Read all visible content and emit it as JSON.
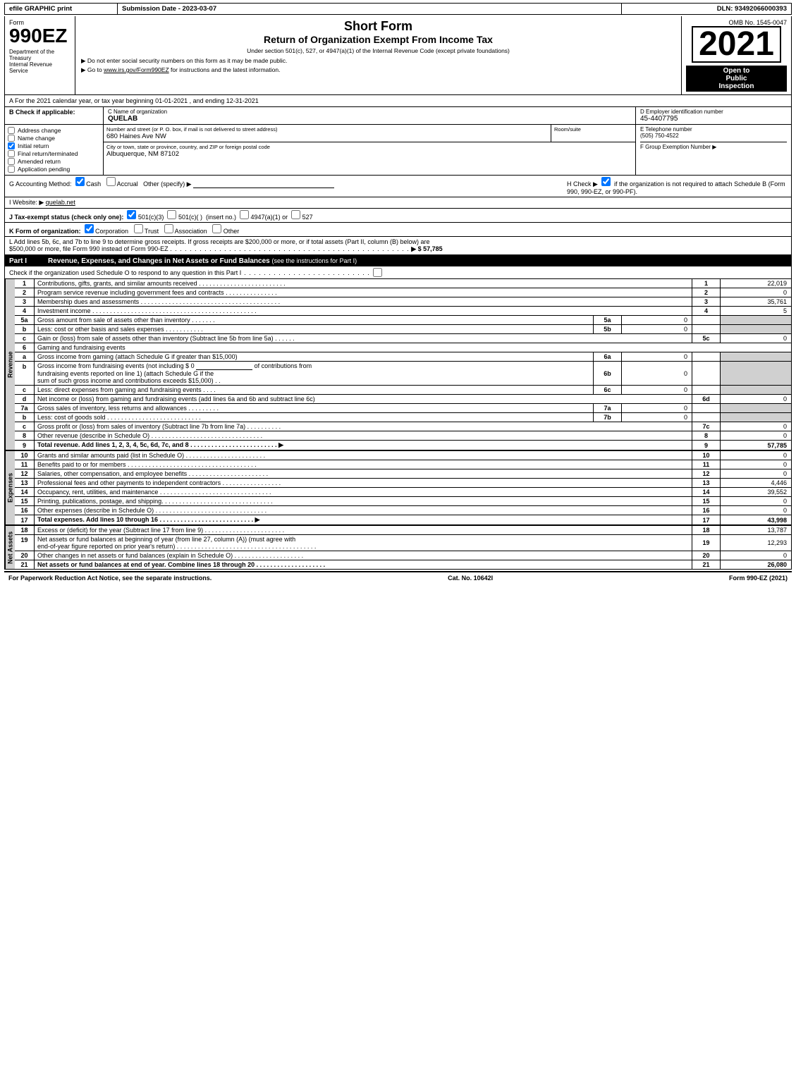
{
  "header": {
    "efile": "efile GRAPHIC print",
    "submission_label": "Submission Date - 2023-03-07",
    "dln": "DLN: 93492066000393"
  },
  "form_info": {
    "form_number": "990EZ",
    "dept_line1": "Department of the",
    "dept_line2": "Treasury",
    "dept_line3": "Internal Revenue",
    "dept_line4": "Service",
    "short_form": "Short Form",
    "title": "Return of Organization Exempt From Income Tax",
    "subtitle": "Under section 501(c), 527, or 4947(a)(1) of the Internal Revenue Code (except private foundations)",
    "instruction1": "▶ Do not enter social security numbers on this form as it may be made public.",
    "instruction2": "▶ Go to www.irs.gov/Form990EZ for instructions and the latest information.",
    "omb": "OMB No. 1545-0047",
    "year": "2021",
    "open_to_public": "Open to",
    "public": "Public",
    "inspection": "Inspection"
  },
  "section_a": {
    "text": "A For the 2021 calendar year, or tax year beginning 01-01-2021 , and ending 12-31-2021"
  },
  "section_b": {
    "label": "B Check if applicable:",
    "address_change": "Address change",
    "name_change": "Name change",
    "initial_return": "Initial return",
    "final_return": "Final return/terminated",
    "amended_return": "Amended return",
    "application_pending": "Application pending",
    "address_change_checked": false,
    "name_change_checked": false,
    "initial_return_checked": true,
    "final_return_checked": false,
    "amended_return_checked": false,
    "application_pending_checked": false
  },
  "section_c": {
    "label": "C Name of organization",
    "org_name": "QUELAB",
    "street_label": "Number and street (or P. O. box, if mail is not delivered to street address)",
    "street_value": "680 Haines Ave NW",
    "room_label": "Room/suite",
    "room_value": "",
    "city_label": "City or town, state or province, country, and ZIP or foreign postal code",
    "city_value": "Albuquerque, NM  87102"
  },
  "section_d": {
    "label": "D Employer identification number",
    "ein": "45-4407795"
  },
  "section_e": {
    "label": "E Telephone number",
    "phone": "(505) 750-4522"
  },
  "section_f": {
    "label": "F Group Exemption",
    "label2": "Number",
    "arrow": "▶"
  },
  "section_g": {
    "text": "G Accounting Method:",
    "cash_label": "Cash",
    "accrual_label": "Accrual",
    "other_label": "Other (specify) ▶",
    "cash_checked": true,
    "accrual_checked": false,
    "h_text": "H Check ▶",
    "h_checked": true,
    "h_detail": "if the organization is not required to attach Schedule B (Form 990, 990-EZ, or 990-PF)."
  },
  "section_i": {
    "label": "I Website: ▶",
    "website": "quelab.net"
  },
  "section_j": {
    "text": "J Tax-exempt status (check only one):",
    "opt1": "501(c)(3)",
    "opt2": "501(c)(  )",
    "opt3": "(insert no.)",
    "opt4": "4947(a)(1) or",
    "opt5": "527",
    "opt1_checked": true,
    "opt2_checked": false,
    "opt4_checked": false,
    "opt5_checked": false
  },
  "section_k": {
    "text": "K Form of organization:",
    "corp": "Corporation",
    "trust": "Trust",
    "assoc": "Association",
    "other": "Other",
    "corp_checked": true,
    "trust_checked": false,
    "assoc_checked": false
  },
  "section_l": {
    "line1": "L Add lines 5b, 6c, and 7b to line 9 to determine gross receipts. If gross receipts are $200,000 or more, or if total assets (Part II, column (B) below) are",
    "line2": "$500,000 or more, file Form 990 instead of Form 990-EZ",
    "dots": ". . . . . . . . . . . . . . . . . . . . . . . . . . . . . . . . . . . . . . . . . . . . . . . . .",
    "arrow": "▶ $",
    "value": "57,785"
  },
  "part1": {
    "label": "Part I",
    "title": "Revenue, Expenses, and Changes in Net Assets or Fund Balances",
    "see_instructions": "(see the instructions for Part I)",
    "check_text": "Check if the organization used Schedule O to respond to any question in this Part I",
    "dots": ". . . . . . . . . . . . . . . . . . . . . . . . . .",
    "checkbox": false,
    "rows": [
      {
        "num": "1",
        "label": "Contributions, gifts, grants, and similar amounts received",
        "dots": ". . . . . . . . . . . . . . . . . . . . . . . . .",
        "line": "1",
        "value": "22,019"
      },
      {
        "num": "2",
        "label": "Program service revenue including government fees and contracts",
        "dots": ". . . . . . . . . . . . . . .",
        "line": "2",
        "value": "0"
      },
      {
        "num": "3",
        "label": "Membership dues and assessments",
        "dots": ". . . . . . . . . . . . . . . . . . . . . . . . . . . . . . . . . . . . . . .",
        "line": "3",
        "value": "35,761"
      },
      {
        "num": "4",
        "label": "Investment income",
        "dots": ". . . . . . . . . . . . . . . . . . . . . . . . . . . . . . . . . . . . . . . . . . . . . . .",
        "line": "4",
        "value": "5"
      },
      {
        "num": "5a",
        "label": "Gross amount from sale of assets other than inventory",
        "dots": ". . . . . . .",
        "mid_label": "5a",
        "mid_value": "0",
        "line": "",
        "value": ""
      },
      {
        "num": "b",
        "label": "Less: cost or other basis and sales expenses",
        "dots": ". . . . . . . . . . .",
        "mid_label": "5b",
        "mid_value": "0",
        "line": "",
        "value": ""
      },
      {
        "num": "c",
        "label": "Gain or (loss) from sale of assets other than inventory (Subtract line 5b from line 5a)",
        "dots": ". . . . . .",
        "line": "5c",
        "value": "0"
      },
      {
        "num": "6",
        "label": "Gaming and fundraising events",
        "line": "",
        "value": ""
      },
      {
        "num": "a",
        "label": "Gross income from gaming (attach Schedule G if greater than $15,000)",
        "mid_label": "6a",
        "mid_value": "0",
        "line": "",
        "value": ""
      },
      {
        "num": "b",
        "label": "Gross income from fundraising events (not including $ 0 of contributions from fundraising events reported on line 1) (attach Schedule G if the sum of such gross income and contributions exceeds $15,000)",
        "mid_label": "6b",
        "mid_value": "0",
        "line": "",
        "value": "",
        "dots2": ". ."
      },
      {
        "num": "c",
        "label": "Less: direct expenses from gaming and fundraising events",
        "dots": ". . . .",
        "mid_label": "6c",
        "mid_value": "0",
        "line": "",
        "value": ""
      },
      {
        "num": "d",
        "label": "Net income or (loss) from gaming and fundraising events (add lines 6a and 6b and subtract line 6c)",
        "line": "6d",
        "value": "0"
      },
      {
        "num": "7a",
        "label": "Gross sales of inventory, less returns and allowances",
        "dots": ". . . . . . . . .",
        "mid_label": "7a",
        "mid_value": "0",
        "line": "",
        "value": ""
      },
      {
        "num": "b",
        "label": "Less: cost of goods sold",
        "dots": ". . . . . . . . . . . . . . . . . . . . . . . . . . .",
        "mid_label": "7b",
        "mid_value": "0",
        "line": "",
        "value": ""
      },
      {
        "num": "c",
        "label": "Gross profit or (loss) from sales of inventory (Subtract line 7b from line 7a)",
        "dots": ". . . . . . . . . .",
        "line": "7c",
        "value": "0"
      },
      {
        "num": "8",
        "label": "Other revenue (describe in Schedule O)",
        "dots": ". . . . . . . . . . . . . . . . . . . . . . . . . . . . . . . .",
        "line": "8",
        "value": "0"
      },
      {
        "num": "9",
        "label": "Total revenue. Add lines 1, 2, 3, 4, 5c, 6d, 7c, and 8",
        "dots": ". . . . . . . . . . . . . . . . . . . . . . . . .",
        "arrow": "▶",
        "line": "9",
        "value": "57,785",
        "bold": true
      }
    ]
  },
  "expenses": {
    "label": "Expenses",
    "rows": [
      {
        "num": "10",
        "label": "Grants and similar amounts paid (list in Schedule O)",
        "dots": ". . . . . . . . . . . . . . . . . . . . . . .",
        "line": "10",
        "value": "0"
      },
      {
        "num": "11",
        "label": "Benefits paid to or for members",
        "dots": ". . . . . . . . . . . . . . . . . . . . . . . . . . . . . . . . . . . . .",
        "line": "11",
        "value": "0"
      },
      {
        "num": "12",
        "label": "Salaries, other compensation, and employee benefits",
        "dots": ". . . . . . . . . . . . . . . . . . . . . . . .",
        "line": "12",
        "value": "0"
      },
      {
        "num": "13",
        "label": "Professional fees and other payments to independent contractors",
        "dots": ". . . . . . . . . . . . . . . . .",
        "line": "13",
        "value": "4,446"
      },
      {
        "num": "14",
        "label": "Occupancy, rent, utilities, and maintenance",
        "dots": ". . . . . . . . . . . . . . . . . . . . . . . . . . . . . . . .",
        "line": "14",
        "value": "39,552"
      },
      {
        "num": "15",
        "label": "Printing, publications, postage, and shipping.",
        "dots": ". . . . . . . . . . . . . . . . . . . . . . . . . . . . . .",
        "line": "15",
        "value": "0"
      },
      {
        "num": "16",
        "label": "Other expenses (describe in Schedule O)",
        "dots": ". . . . . . . . . . . . . . . . . . . . . . . . . . . . . . . .",
        "line": "16",
        "value": "0"
      },
      {
        "num": "17",
        "label": "Total expenses. Add lines 10 through 16",
        "dots": ". . . . . . . . . . . . . . . . . . . . . . . . . . .",
        "arrow": "▶",
        "line": "17",
        "value": "43,998",
        "bold": true
      }
    ]
  },
  "net_assets": {
    "label": "Net Assets",
    "rows": [
      {
        "num": "18",
        "label": "Excess or (deficit) for the year (Subtract line 17 from line 9)",
        "dots": ". . . . . . . . . . . . . . . . . . . . . . . .",
        "line": "18",
        "value": "13,787"
      },
      {
        "num": "19",
        "label": "Net assets or fund balances at beginning of year (from line 27, column (A)) (must agree with end-of-year figure reported on prior year's return)",
        "dots": ". . . . . . . . . . . . . . . . . . . . . . . . . . . . . . . . . . . . . . . .",
        "line": "19",
        "value": "12,293"
      },
      {
        "num": "20",
        "label": "Other changes in net assets or fund balances (explain in Schedule O)",
        "dots": ". . . . . . . . . . . . . . . . . . . . .",
        "line": "20",
        "value": "0"
      },
      {
        "num": "21",
        "label": "Net assets or fund balances at end of year. Combine lines 18 through 20",
        "dots": ". . . . . . . . . . . . . . . . . . . . .",
        "line": "21",
        "value": "26,080",
        "bold": true
      }
    ]
  },
  "footer": {
    "paperwork": "For Paperwork Reduction Act Notice, see the separate instructions.",
    "cat": "Cat. No. 10642I",
    "form": "Form 990-EZ (2021)"
  }
}
